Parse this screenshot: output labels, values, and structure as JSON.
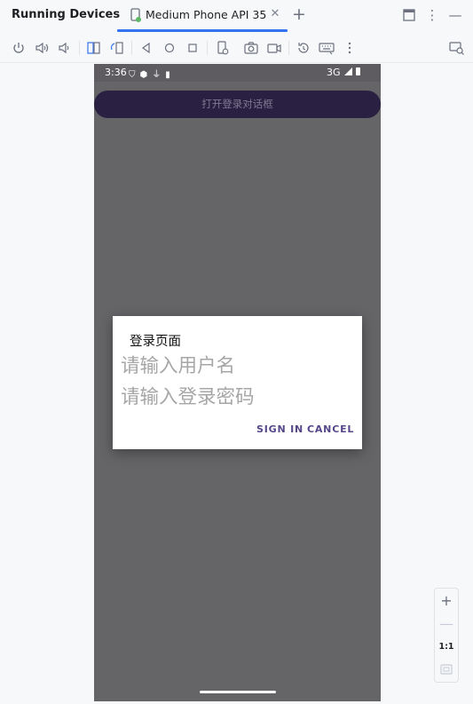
{
  "panel": {
    "title": "Running Devices"
  },
  "tab": {
    "label": "Medium Phone API 35",
    "icon": "device-phone-icon",
    "close_icon": "close-icon"
  },
  "tabbar_actions": [
    {
      "name": "add-tab-icon",
      "glyph": "+"
    },
    {
      "name": "layout-icon",
      "glyph": "▭"
    },
    {
      "name": "more-options-icon",
      "glyph": "⋮"
    },
    {
      "name": "minimize-icon",
      "glyph": "—"
    }
  ],
  "toolbar": {
    "tools": [
      "power-icon",
      "volume-up-icon",
      "volume-down-icon",
      "rotate-left-icon",
      "rotate-right-icon",
      "back-icon",
      "home-icon",
      "overview-icon",
      "device-settings-icon",
      "screenshot-icon",
      "screen-record-icon",
      "reset-icon",
      "keyboard-icon",
      "more-icon",
      "mirror-icon"
    ]
  },
  "device": {
    "status": {
      "time": "3:36",
      "network": "3G"
    },
    "app_button_label": "打开登录对话框"
  },
  "dialog": {
    "title": "登录页面",
    "username_placeholder": "请输入用户名",
    "password_placeholder": "请输入登录密码",
    "signin_label": "SIGN IN",
    "cancel_label": "CANCEL"
  },
  "zoom": {
    "zoom_in": "+",
    "zoom_out": "—",
    "actual_size": "1:1"
  },
  "colors": {
    "accent": "#3574f0",
    "device_bg": "#656467",
    "dialog_button": "#56468a",
    "app_button": "#2a2142"
  }
}
